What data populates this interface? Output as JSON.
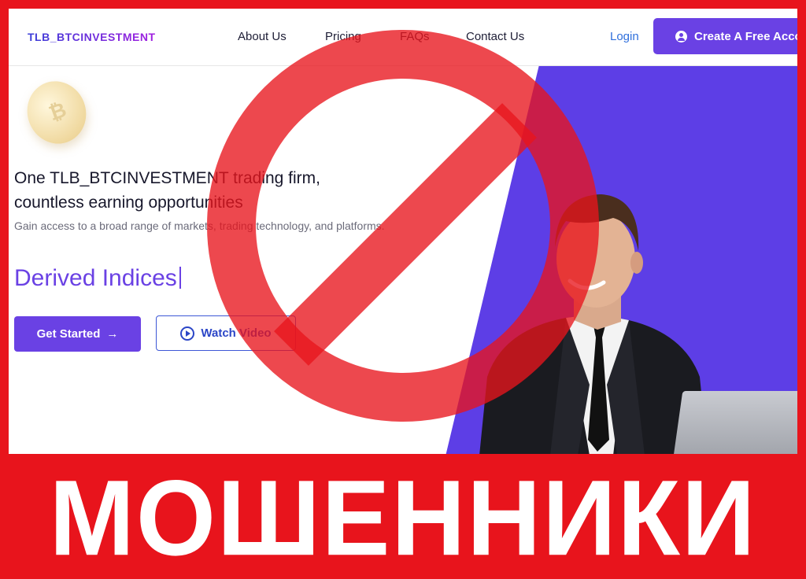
{
  "header": {
    "logo": "TLB_BTCINVESTMENT",
    "nav": [
      "About Us",
      "Pricing",
      "FAQs",
      "Contact Us"
    ],
    "login": "Login",
    "cta": "Create A Free Acco"
  },
  "hero": {
    "headline_line1": "One TLB_BTCINVESTMENT trading firm,",
    "headline_line2": "countless earning opportunities",
    "subline": "Gain access to a broad range of markets, trading technology, and platforms.",
    "typed": "Derived Indices",
    "btn_start": "Get Started",
    "btn_start_icon": "→",
    "btn_watch": "Watch Video"
  },
  "colors": {
    "brand": "#6a41e4",
    "ban_red": "#e8141c"
  },
  "banner": {
    "text": "МОШЕННИКИ"
  }
}
